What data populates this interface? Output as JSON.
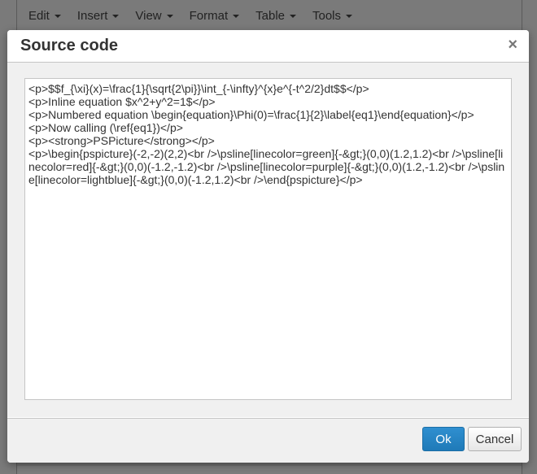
{
  "menubar": {
    "items": [
      {
        "label": "Edit"
      },
      {
        "label": "Insert"
      },
      {
        "label": "View"
      },
      {
        "label": "Format"
      },
      {
        "label": "Table"
      },
      {
        "label": "Tools"
      }
    ]
  },
  "dialog": {
    "title": "Source code",
    "close_label": "×",
    "source": "<p>$$f_{\\xi}(x)=\\frac{1}{\\sqrt{2\\pi}}\\int_{-\\infty}^{x}e^{-t^2/2}dt$$</p>\n<p>Inline equation $x^2+y^2=1$</p>\n<p>Numbered equation \\begin{equation}\\Phi(0)=\\frac{1}{2}\\label{eq1}\\end{equation}</p>\n<p>Now calling (\\ref{eq1})</p>\n<p><strong>PSPicture</strong></p>\n<p>\\begin{pspicture}(-2,-2)(2,2)<br />\\psline[linecolor=green]{-&gt;}(0,0)(1.2,1.2)<br />\\psline[linecolor=red]{-&gt;}(0,0)(-1.2,-1.2)<br />\\psline[linecolor=purple]{-&gt;}(0,0)(1.2,-1.2)<br />\\psline[linecolor=lightblue]{-&gt;}(0,0)(-1.2,1.2)<br />\\end{pspicture}</p>",
    "ok_label": "Ok",
    "cancel_label": "Cancel"
  },
  "colors": {
    "primary_button": "#2d8ac7",
    "overlay": "#7a7a7a"
  }
}
